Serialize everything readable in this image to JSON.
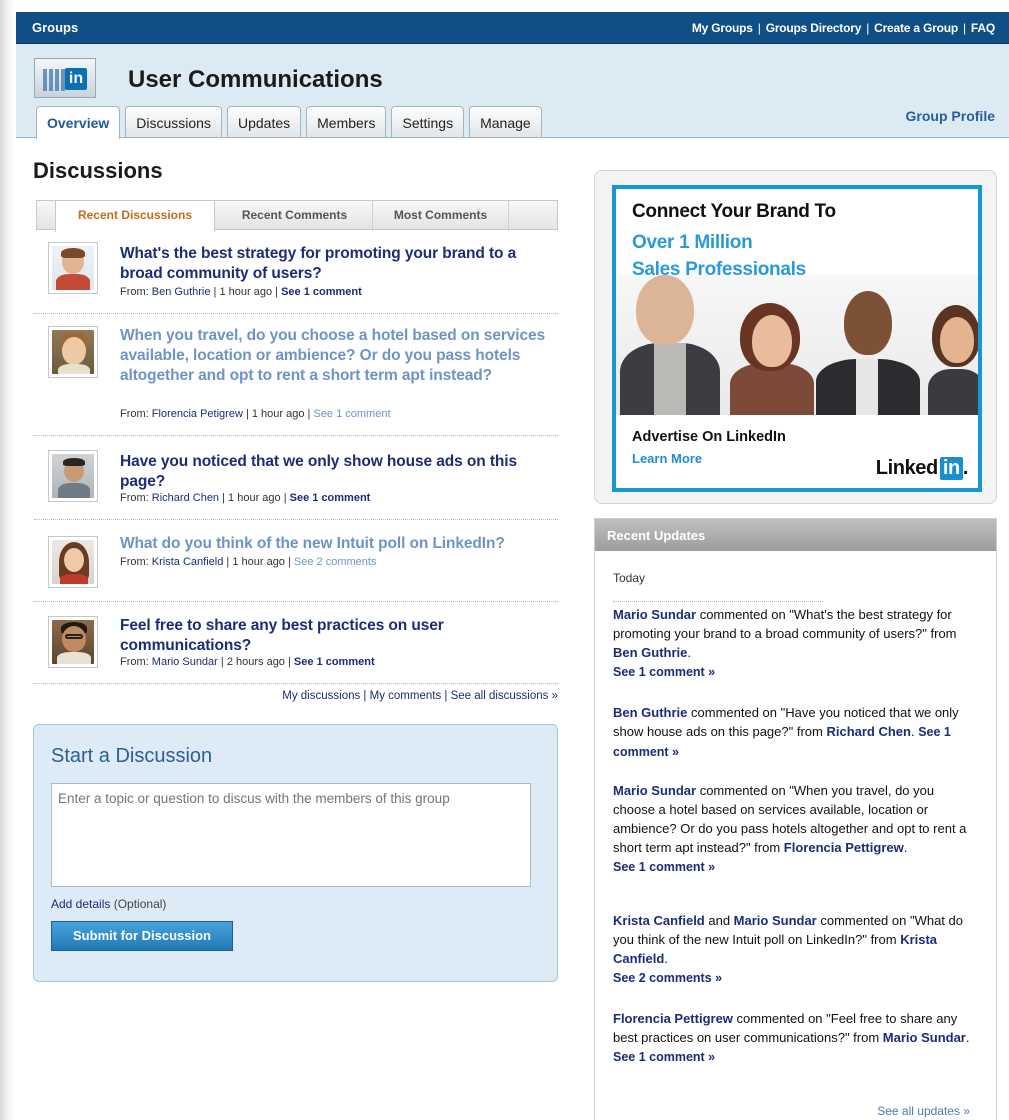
{
  "topbar": {
    "brand": "Groups",
    "links": [
      "My Groups",
      "Groups Directory",
      "Create a Group",
      "FAQ"
    ],
    "separator": "|"
  },
  "header": {
    "logo_icon": "group-logo-linkedin-icon",
    "logo_text": "in",
    "title": "User Communications",
    "group_profile": "Group Profile",
    "tabs": [
      "Overview",
      "Discussions",
      "Updates",
      "Members",
      "Settings",
      "Manage"
    ],
    "active_tab": "Overview"
  },
  "discussions": {
    "heading": "Discussions",
    "subtabs": [
      "Recent Discussions",
      "Recent Comments",
      "Most Comments"
    ],
    "items": [
      {
        "question": "What's the best strategy for promoting your brand to a broad community of users?",
        "from_label": "From:",
        "author": "Ben Guthrie",
        "time": "1 hour ago",
        "comments": "See 1 comment"
      },
      {
        "question": "When you travel, do you choose a hotel based on services available, location or ambience? Or do you pass hotels altogether and opt to rent a short term apt instead?",
        "from_label": "From:",
        "author": "Florencia Petigrew",
        "time": "1 hour ago",
        "comments": "See 1 comment"
      },
      {
        "question": "Have you noticed that we only show house ads on this page?",
        "from_label": "From:",
        "author": "Richard Chen",
        "time": "1 hour ago",
        "comments": "See 1 comment"
      },
      {
        "question": "What do you think of the new Intuit poll on LinkedIn?",
        "from_label": "From:",
        "author": "Krista Canfield",
        "time": "1 hour ago",
        "comments": "See 2 comments"
      },
      {
        "question": "Feel free to share any best practices on user communications?",
        "from_label": "From:",
        "author": "Mario Sundar",
        "time": "2 hours ago",
        "comments": "See 1 comment"
      }
    ],
    "footer_links": {
      "my_discussions": "My discussions",
      "my_comments": "My comments",
      "see_all": "See all discussions »"
    }
  },
  "start_discussion": {
    "title": "Start a Discussion",
    "placeholder": "Enter a topic or question to discus with the members of this group",
    "add_details": "Add details",
    "optional": "(Optional)",
    "submit": "Submit for Discussion"
  },
  "ad": {
    "line1": "Connect Your Brand To",
    "line2": "Over 1 Million",
    "line3": "Sales Professionals",
    "advertise": "Advertise On LinkedIn",
    "learn_more": "Learn More",
    "logo_text": "Linked",
    "logo_in": "in",
    "logo_dot": ".",
    "accent": "#1a8fd0"
  },
  "recent_updates": {
    "header": "Recent Updates",
    "today": "Today",
    "updates": [
      {
        "parts": [
          {
            "t": "Mario Sundar",
            "name": true
          },
          {
            "t": " commented on \"What's the best strategy for promoting your brand to a broad community of users?\" from "
          },
          {
            "t": "Ben Guthrie",
            "name": true
          },
          {
            "t": "."
          }
        ],
        "see": "See 1 comment »"
      },
      {
        "parts": [
          {
            "t": "Ben Guthrie",
            "name": true
          },
          {
            "t": " commented on \"Have you noticed that we only show house ads on this page?\" from "
          },
          {
            "t": "Richard Chen",
            "name": true
          },
          {
            "t": ". "
          }
        ],
        "see": "See 1 comment »",
        "inline_see": true
      },
      {
        "parts": [
          {
            "t": "Mario Sundar",
            "name": true
          },
          {
            "t": " commented on \"When you travel, do you choose a hotel based on services available, location or ambience? Or do you pass hotels altogether and opt to rent a short term apt instead?\" from "
          },
          {
            "t": "Florencia Pettigrew",
            "name": true
          },
          {
            "t": "."
          }
        ],
        "see": "See 1 comment »"
      },
      {
        "parts": [
          {
            "t": "Krista Canfield",
            "name": true
          },
          {
            "t": " and "
          },
          {
            "t": "Mario Sundar",
            "name": true
          },
          {
            "t": " commented on \"What do you think of the new Intuit poll on LinkedIn?\" from "
          },
          {
            "t": "Krista Canfield",
            "name": true
          },
          {
            "t": "."
          }
        ],
        "see": "See 2 comments »"
      },
      {
        "parts": [
          {
            "t": "Florencia Pettigrew",
            "name": true
          },
          {
            "t": " commented on \"Feel free to share any best practices on user communications?\" from "
          },
          {
            "t": "Mario Sundar",
            "name": true
          },
          {
            "t": "."
          }
        ],
        "see": "See 1 comment »"
      }
    ],
    "see_all": "See all updates »"
  },
  "colors": {
    "topbar": "#104f85",
    "link_dark": "#1c2c78",
    "link_light": "#6e93c6",
    "header_bg": "#dcebf3",
    "subtab_active": "#c56c1b"
  }
}
